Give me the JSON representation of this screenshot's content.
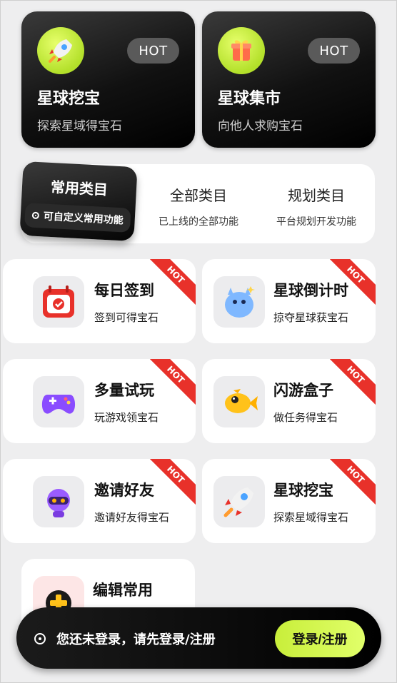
{
  "top_features": [
    {
      "title": "星球挖宝",
      "subtitle": "探索星域得宝石",
      "badge": "HOT",
      "icon": "rocket-icon"
    },
    {
      "title": "星球集市",
      "subtitle": "向他人求购宝石",
      "badge": "HOT",
      "icon": "gift-box-icon"
    }
  ],
  "tabs": [
    {
      "title": "常用类目",
      "subtitle": "可自定义常用功能",
      "active": true
    },
    {
      "title": "全部类目",
      "subtitle": "已上线的全部功能",
      "active": false
    },
    {
      "title": "规划类目",
      "subtitle": "平台规划开发功能",
      "active": false
    }
  ],
  "cards": [
    {
      "title": "每日签到",
      "subtitle": "签到可得宝石",
      "badge": "HOT",
      "icon": "calendar-icon"
    },
    {
      "title": "星球倒计时",
      "subtitle": "掠夺星球获宝石",
      "badge": "HOT",
      "icon": "blue-creature-icon"
    },
    {
      "title": "多量试玩",
      "subtitle": "玩游戏领宝石",
      "badge": "HOT",
      "icon": "gamepad-icon"
    },
    {
      "title": "闪游盒子",
      "subtitle": "做任务得宝石",
      "badge": "HOT",
      "icon": "yellow-fish-icon"
    },
    {
      "title": "邀请好友",
      "subtitle": "邀请好友得宝石",
      "badge": "HOT",
      "icon": "robot-icon"
    },
    {
      "title": "星球挖宝",
      "subtitle": "探索星域得宝石",
      "badge": "HOT",
      "icon": "rocket-icon"
    },
    {
      "title": "编辑常用",
      "icon": "plus-icon"
    }
  ],
  "login_bar": {
    "message": "您还未登录，请先登录/注册",
    "button": "登录/注册"
  },
  "colors": {
    "accent": "#c8ee3a",
    "hot_red": "#e8312a",
    "dark": "#111111"
  }
}
